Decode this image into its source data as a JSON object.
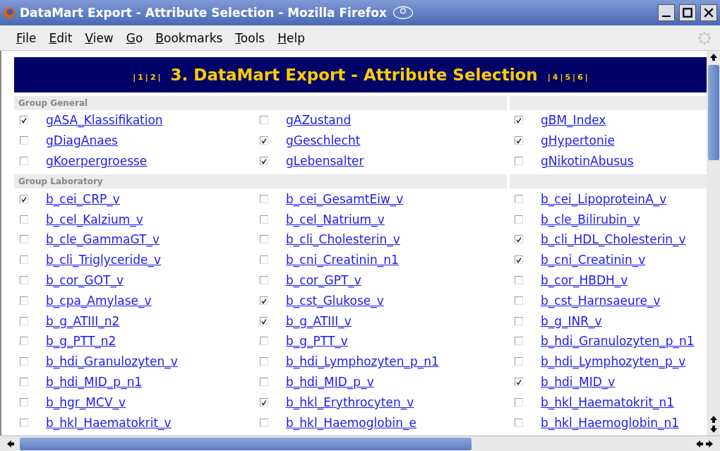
{
  "window": {
    "title": "DataMart Export - Attribute Selection - Mozilla Firefox"
  },
  "menu": [
    "File",
    "Edit",
    "View",
    "Go",
    "Bookmarks",
    "Tools",
    "Help"
  ],
  "banner": {
    "title": "3. DataMart Export - Attribute Selection",
    "separator": "|",
    "nav_before": [
      "1",
      "2"
    ],
    "nav_after": [
      "4",
      "5",
      "6"
    ]
  },
  "groups": [
    {
      "name": "Group General",
      "items": [
        {
          "label": "gASA_Klassifikation",
          "checked": true
        },
        {
          "label": "gAZustand",
          "checked": false
        },
        {
          "label": "gBM_Index",
          "checked": true
        },
        {
          "label": "gDiagAnaes",
          "checked": false
        },
        {
          "label": "gGeschlecht",
          "checked": true
        },
        {
          "label": "gHypertonie",
          "checked": true
        },
        {
          "label": "gKoerpergroesse",
          "checked": false
        },
        {
          "label": "gLebensalter",
          "checked": true
        },
        {
          "label": "gNikotinAbusus",
          "checked": false
        }
      ]
    },
    {
      "name": "Group Laboratory",
      "items": [
        {
          "label": "b_cei_CRP_v",
          "checked": true
        },
        {
          "label": "b_cei_GesamtEiw_v",
          "checked": false
        },
        {
          "label": "b_cei_LipoproteinA_v",
          "checked": false
        },
        {
          "label": "b_cel_Kalzium_v",
          "checked": false
        },
        {
          "label": "b_cel_Natrium_v",
          "checked": false
        },
        {
          "label": "b_cle_Bilirubin_v",
          "checked": false
        },
        {
          "label": "b_cle_GammaGT_v",
          "checked": false
        },
        {
          "label": "b_cli_Cholesterin_v",
          "checked": false
        },
        {
          "label": "b_cli_HDL_Cholesterin_v",
          "checked": true
        },
        {
          "label": "b_cli_Triglyceride_v",
          "checked": false
        },
        {
          "label": "b_cni_Creatinin_n1",
          "checked": false
        },
        {
          "label": "b_cni_Creatinin_v",
          "checked": true
        },
        {
          "label": "b_cor_GOT_v",
          "checked": false
        },
        {
          "label": "b_cor_GPT_v",
          "checked": false
        },
        {
          "label": "b_cor_HBDH_v",
          "checked": false
        },
        {
          "label": "b_cpa_Amylase_v",
          "checked": false
        },
        {
          "label": "b_cst_Glukose_v",
          "checked": true
        },
        {
          "label": "b_cst_Harnsaeure_v",
          "checked": false
        },
        {
          "label": "b_g_ATIII_n2",
          "checked": false
        },
        {
          "label": "b_g_ATIII_v",
          "checked": true
        },
        {
          "label": "b_g_INR_v",
          "checked": false
        },
        {
          "label": "b_g_PTT_n2",
          "checked": false
        },
        {
          "label": "b_g_PTT_v",
          "checked": false
        },
        {
          "label": "b_hdi_Granulozyten_p_n1",
          "checked": false
        },
        {
          "label": "b_hdi_Granulozyten_v",
          "checked": false
        },
        {
          "label": "b_hdi_Lymphozyten_p_n1",
          "checked": false
        },
        {
          "label": "b_hdi_Lymphozyten_p_v",
          "checked": false
        },
        {
          "label": "b_hdi_MID_p_n1",
          "checked": false
        },
        {
          "label": "b_hdi_MID_p_v",
          "checked": false
        },
        {
          "label": "b_hdi_MID_v",
          "checked": true
        },
        {
          "label": "b_hgr_MCV_v",
          "checked": false
        },
        {
          "label": "b_hkl_Erythrocyten_v",
          "checked": true
        },
        {
          "label": "b_hkl_Haematokrit_n1",
          "checked": false
        },
        {
          "label": "b_hkl_Haematokrit_v",
          "checked": false
        },
        {
          "label": "b_hkl_Haemoglobin_e",
          "checked": false
        },
        {
          "label": "b_hkl_Haemoglobin_n1",
          "checked": false
        }
      ]
    }
  ]
}
